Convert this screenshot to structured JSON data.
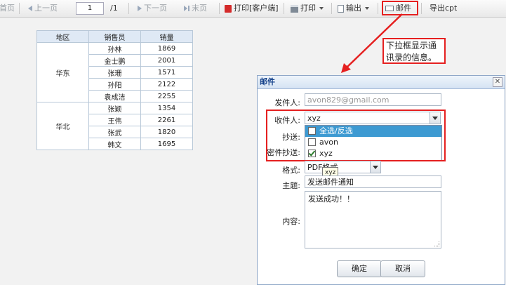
{
  "toolbar": {
    "first": "首页",
    "prev": "上一页",
    "page_value": "1",
    "page_total": "/1",
    "next": "下一页",
    "last": "末页",
    "print_client": "打印[客户端]",
    "print": "打印",
    "export": "输出",
    "mail": "邮件",
    "export_cpt": "导出cpt"
  },
  "report": {
    "headers": [
      "地区",
      "销售员",
      "销量"
    ],
    "groups": [
      {
        "region": "华东",
        "rows": [
          [
            "孙林",
            "1869"
          ],
          [
            "金士鹏",
            "2001"
          ],
          [
            "张珊",
            "1571"
          ],
          [
            "孙阳",
            "2122"
          ],
          [
            "袁成洁",
            "2255"
          ]
        ]
      },
      {
        "region": "华北",
        "rows": [
          [
            "张颖",
            "1354"
          ],
          [
            "王伟",
            "2261"
          ],
          [
            "张武",
            "1820"
          ],
          [
            "韩文",
            "1695"
          ]
        ]
      }
    ]
  },
  "callout": {
    "text": "下拉框显示通讯录的信息。"
  },
  "dialog": {
    "title": "邮件",
    "sender_label": "发件人:",
    "sender_value": "avon829@gmail.com",
    "to_label": "收件人:",
    "to_value": "xyz",
    "cc_label": "抄送:",
    "bcc_label": "密件抄送:",
    "format_label": "格式:",
    "format_value": "PDF格式",
    "subject_label": "主题:",
    "subject_value": "发送邮件通知",
    "content_label": "内容:",
    "content_value": "发送成功！！",
    "ok": "确定",
    "cancel": "取消",
    "dropdown": [
      {
        "label": "全选/反选",
        "checked": false,
        "selected": true
      },
      {
        "label": "avon",
        "checked": false,
        "selected": false
      },
      {
        "label": "xyz",
        "checked": true,
        "selected": false
      }
    ],
    "tooltip": "xyz"
  },
  "colors": {
    "highlight_red": "#e52020",
    "selection_blue": "#3d9ad2",
    "title_blue": "#15428b"
  }
}
